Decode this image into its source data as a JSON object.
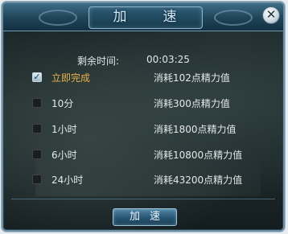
{
  "dialog": {
    "title": "加　速",
    "close_symbol": "✕",
    "remaining_label": "剩余时间:",
    "remaining_value": "00:03:25",
    "options": [
      {
        "label": "立即完成",
        "cost": "消耗102点精力值",
        "checked": true
      },
      {
        "label": "10分",
        "cost": "消耗300点精力值",
        "checked": false
      },
      {
        "label": "1小时",
        "cost": "消耗1800点精力值",
        "checked": false
      },
      {
        "label": "6小时",
        "cost": "消耗10800点精力值",
        "checked": false
      },
      {
        "label": "24小时",
        "cost": "消耗43200点精力值",
        "checked": false
      }
    ],
    "check_mark": "✓",
    "confirm_label": "加速",
    "colors": {
      "active_option": "#e9b24a",
      "text": "#e3e8ea",
      "title": "#cfe6f4"
    }
  }
}
